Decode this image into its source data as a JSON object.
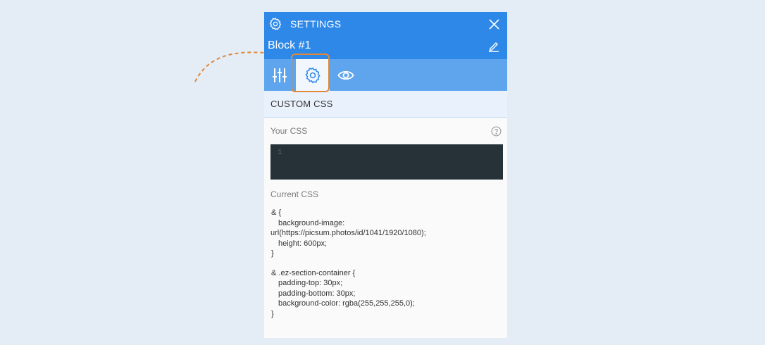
{
  "header": {
    "title": "SETTINGS",
    "block_name": "Block #1"
  },
  "tabs": [
    {
      "name": "layout",
      "icon": "sliders-icon"
    },
    {
      "name": "settings",
      "icon": "gear-icon",
      "active": true
    },
    {
      "name": "visibility",
      "icon": "eye-icon"
    }
  ],
  "section": {
    "title": "CUSTOM CSS"
  },
  "your_css": {
    "label": "Your CSS",
    "line_number": "1"
  },
  "current_css": {
    "label": "Current CSS",
    "rules": [
      {
        "lines": [
          {
            "text": "& {",
            "indent": false
          },
          {
            "text": "background-image:",
            "indent": true
          },
          {
            "text": "url(https://picsum.photos/id/1041/1920/1080);",
            "indent": false,
            "flush": true
          },
          {
            "text": "height: 600px;",
            "indent": true
          },
          {
            "text": "}",
            "indent": false
          }
        ]
      },
      {
        "lines": [
          {
            "text": "& .ez-section-container {",
            "indent": false
          },
          {
            "text": "padding-top: 30px;",
            "indent": true
          },
          {
            "text": "padding-bottom: 30px;",
            "indent": true
          },
          {
            "text": "background-color: rgba(255,255,255,0);",
            "indent": true
          },
          {
            "text": "}",
            "indent": false
          }
        ]
      }
    ]
  },
  "colors": {
    "header_bg": "#2e88e8",
    "tabbar_bg": "#5fa5ee",
    "highlight": "#e0883a",
    "editor_bg": "#263238"
  }
}
